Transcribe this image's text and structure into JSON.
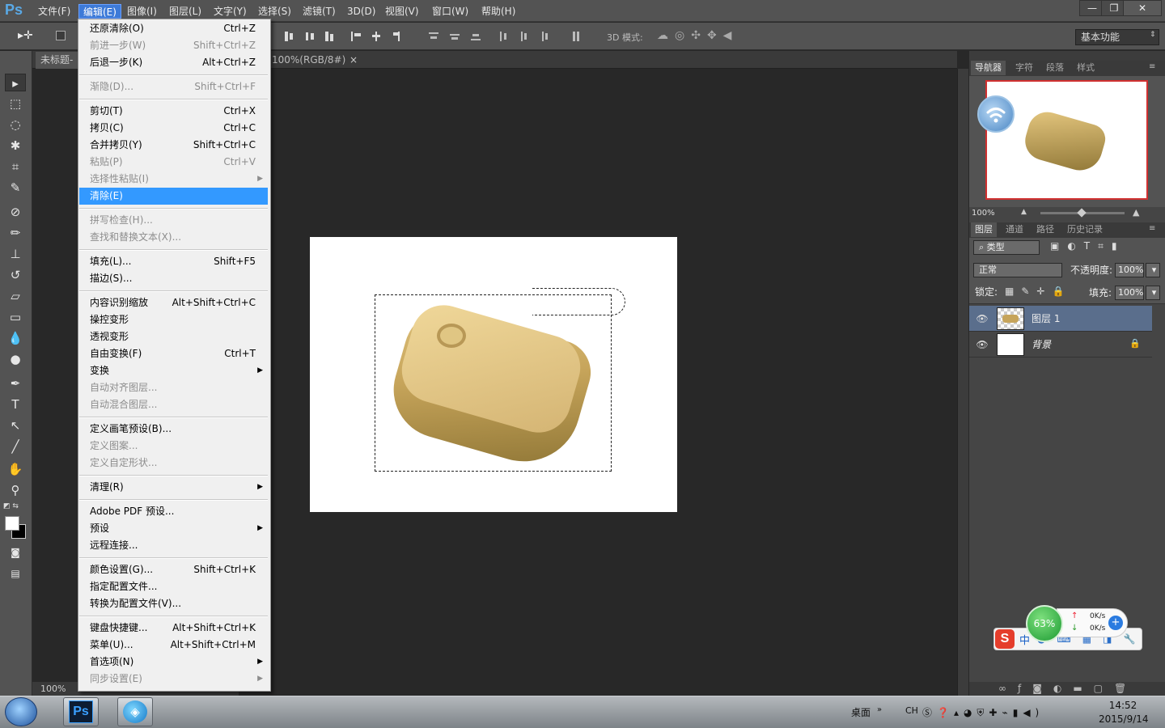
{
  "app": {
    "logo": "Ps"
  },
  "menubar": {
    "items": [
      "文件(F)",
      "编辑(E)",
      "图像(I)",
      "图层(L)",
      "文字(Y)",
      "选择(S)",
      "滤镜(T)",
      "3D(D)",
      "视图(V)",
      "窗口(W)",
      "帮助(H)"
    ],
    "active_index": 1
  },
  "window_controls": {
    "minimize": "—",
    "restore": "❐",
    "close": "✕"
  },
  "options_bar": {
    "mode_label": "3D 模式:",
    "workspace": "基本功能"
  },
  "document": {
    "tab1": "未标题-",
    "tab2": "100%(RGB/8#)",
    "close_icon": "×"
  },
  "status": {
    "zoom": "100%"
  },
  "edit_menu": {
    "items": [
      {
        "label": "还原清除(O)",
        "shortcut": "Ctrl+Z",
        "disabled": false
      },
      {
        "label": "前进一步(W)",
        "shortcut": "Shift+Ctrl+Z",
        "disabled": true
      },
      {
        "label": "后退一步(K)",
        "shortcut": "Alt+Ctrl+Z",
        "disabled": false
      },
      {
        "sep": true
      },
      {
        "label": "渐隐(D)...",
        "shortcut": "Shift+Ctrl+F",
        "disabled": true
      },
      {
        "sep": true
      },
      {
        "label": "剪切(T)",
        "shortcut": "Ctrl+X",
        "disabled": false
      },
      {
        "label": "拷贝(C)",
        "shortcut": "Ctrl+C",
        "disabled": false
      },
      {
        "label": "合并拷贝(Y)",
        "shortcut": "Shift+Ctrl+C",
        "disabled": false
      },
      {
        "label": "粘贴(P)",
        "shortcut": "Ctrl+V",
        "disabled": true
      },
      {
        "label": "选择性粘贴(I)",
        "shortcut": "",
        "disabled": true,
        "submenu": true
      },
      {
        "label": "清除(E)",
        "shortcut": "",
        "disabled": false,
        "highlighted": true
      },
      {
        "sep": true
      },
      {
        "label": "拼写检查(H)...",
        "shortcut": "",
        "disabled": true
      },
      {
        "label": "查找和替换文本(X)...",
        "shortcut": "",
        "disabled": true
      },
      {
        "sep": true
      },
      {
        "label": "填充(L)...",
        "shortcut": "Shift+F5",
        "disabled": false
      },
      {
        "label": "描边(S)...",
        "shortcut": "",
        "disabled": false
      },
      {
        "sep": true
      },
      {
        "label": "内容识别缩放",
        "shortcut": "Alt+Shift+Ctrl+C",
        "disabled": false
      },
      {
        "label": "操控变形",
        "shortcut": "",
        "disabled": false
      },
      {
        "label": "透视变形",
        "shortcut": "",
        "disabled": false
      },
      {
        "label": "自由变换(F)",
        "shortcut": "Ctrl+T",
        "disabled": false
      },
      {
        "label": "变换",
        "shortcut": "",
        "disabled": false,
        "submenu": true
      },
      {
        "label": "自动对齐图层...",
        "shortcut": "",
        "disabled": true
      },
      {
        "label": "自动混合图层...",
        "shortcut": "",
        "disabled": true
      },
      {
        "sep": true
      },
      {
        "label": "定义画笔预设(B)...",
        "shortcut": "",
        "disabled": false
      },
      {
        "label": "定义图案...",
        "shortcut": "",
        "disabled": true
      },
      {
        "label": "定义自定形状...",
        "shortcut": "",
        "disabled": true
      },
      {
        "sep": true
      },
      {
        "label": "清理(R)",
        "shortcut": "",
        "disabled": false,
        "submenu": true
      },
      {
        "sep": true
      },
      {
        "label": "Adobe PDF 预设...",
        "shortcut": "",
        "disabled": false
      },
      {
        "label": "预设",
        "shortcut": "",
        "disabled": false,
        "submenu": true
      },
      {
        "label": "远程连接...",
        "shortcut": "",
        "disabled": false
      },
      {
        "sep": true
      },
      {
        "label": "颜色设置(G)...",
        "shortcut": "Shift+Ctrl+K",
        "disabled": false
      },
      {
        "label": "指定配置文件...",
        "shortcut": "",
        "disabled": false
      },
      {
        "label": "转换为配置文件(V)...",
        "shortcut": "",
        "disabled": false
      },
      {
        "sep": true
      },
      {
        "label": "键盘快捷键...",
        "shortcut": "Alt+Shift+Ctrl+K",
        "disabled": false
      },
      {
        "label": "菜单(U)...",
        "shortcut": "Alt+Shift+Ctrl+M",
        "disabled": false
      },
      {
        "label": "首选项(N)",
        "shortcut": "",
        "disabled": false,
        "submenu": true
      },
      {
        "label": "同步设置(E)",
        "shortcut": "",
        "disabled": true,
        "submenu": true
      }
    ]
  },
  "navigator": {
    "tabs": [
      "导航器",
      "字符",
      "段落",
      "样式"
    ],
    "zoom": "100%"
  },
  "layers_panel": {
    "tabs": [
      "图层",
      "通道",
      "路径",
      "历史记录"
    ],
    "filter": "类型",
    "blend_mode": "正常",
    "opacity_label": "不透明度:",
    "opacity": "100%",
    "lock_label": "锁定:",
    "fill_label": "填充:",
    "fill": "100%",
    "layers": [
      {
        "name": "图层 1",
        "selected": true
      },
      {
        "name": "背景",
        "selected": false
      }
    ]
  },
  "net_widget": {
    "percent": "63%",
    "up": "0K/s",
    "down": "0K/s"
  },
  "ime": {
    "lang": "中"
  },
  "taskbar": {
    "desktop": "桌面",
    "lang": "CH",
    "time": "14:52",
    "date": "2015/9/14"
  },
  "colors": {
    "menu_highlight": "#3399ff",
    "ps_blue": "#3aa0ff",
    "selection_red": "#d03030"
  }
}
